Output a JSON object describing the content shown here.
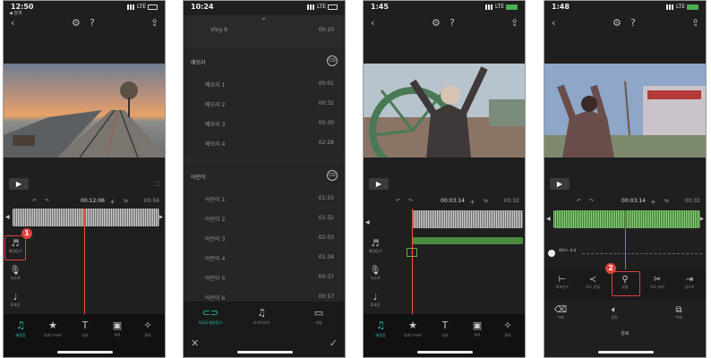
{
  "panel1": {
    "time": "12:50",
    "back": "◀ 검색",
    "network": "LTE",
    "timecode": "00:12:06",
    "duration": "00:56",
    "tools": [
      {
        "label": "배경음악"
      },
      {
        "label": "녹소리"
      },
      {
        "label": "효과음"
      }
    ],
    "badge": "1",
    "bottom_tabs": [
      {
        "label": "배경음",
        "icon": "music-icon"
      },
      {
        "label": "효과 스티커",
        "icon": "sticker-icon"
      },
      {
        "label": "글자",
        "icon": "text-icon"
      },
      {
        "label": "PIP",
        "icon": "pip-icon"
      },
      {
        "label": "필터",
        "icon": "filter-icon"
      }
    ]
  },
  "panel2": {
    "time": "10:24",
    "network": "LTE",
    "first_item": {
      "name": "Vlog 8",
      "duration": "00:10"
    },
    "sections": [
      {
        "title": "메모리",
        "badge": "CO",
        "items": [
          {
            "name": "메모리 1",
            "duration": "00:01"
          },
          {
            "name": "메모리 2",
            "duration": "00:32"
          },
          {
            "name": "메모리 3",
            "duration": "00:30"
          },
          {
            "name": "메모리 4",
            "duration": "02:28"
          }
        ]
      },
      {
        "title": "어린이",
        "badge": "CO",
        "items": [
          {
            "name": "어린이 1",
            "duration": "01:55"
          },
          {
            "name": "어린이 2",
            "duration": "01:32"
          },
          {
            "name": "어린이 3",
            "duration": "02:03"
          },
          {
            "name": "어린이 4",
            "duration": "01:34"
          },
          {
            "name": "어린이 5",
            "duration": "00:37"
          },
          {
            "name": "어린이 6",
            "duration": "00:17"
          }
        ]
      }
    ],
    "bottom_tabs": [
      {
        "label": "VLLO 배경음악",
        "icon": "vllo-icon"
      },
      {
        "label": "라이브러리",
        "icon": "music-icon"
      },
      {
        "label": "파일",
        "icon": "folder-icon"
      }
    ]
  },
  "panel3": {
    "time": "1:45",
    "network": "LTE",
    "timecode": "00:03:14",
    "duration": "00:32",
    "tools": [
      {
        "label": "배경음악"
      },
      {
        "label": "녹소리"
      },
      {
        "label": "효과음"
      }
    ],
    "bottom_tabs": [
      {
        "label": "배경음",
        "icon": "music-icon"
      },
      {
        "label": "효과 스티커",
        "icon": "sticker-icon"
      },
      {
        "label": "글자",
        "icon": "text-icon"
      },
      {
        "label": "PIP",
        "icon": "pip-icon"
      },
      {
        "label": "필터",
        "icon": "filter-icon"
      }
    ]
  },
  "panel4": {
    "time": "1:48",
    "network": "LTE",
    "timecode": "00:03:14",
    "duration": "00:32",
    "fade_label": "페이드 효과",
    "badge": "2",
    "tools_row1": [
      {
        "label": "퍼포먼스",
        "icon": "trim-icon"
      },
      {
        "label": "속도 분할",
        "icon": "split-icon"
      },
      {
        "label": "분할",
        "icon": "cut-icon"
      },
      {
        "label": "속도 분리",
        "icon": "scissors-icon"
      },
      {
        "label": "앞으로",
        "icon": "forward-icon"
      }
    ],
    "tools_row2": [
      {
        "label": "삭제",
        "icon": "delete-icon"
      },
      {
        "label": "음량",
        "icon": "volume-icon"
      },
      {
        "label": "복제",
        "icon": "copy-icon"
      }
    ],
    "done_label": "완료"
  }
}
